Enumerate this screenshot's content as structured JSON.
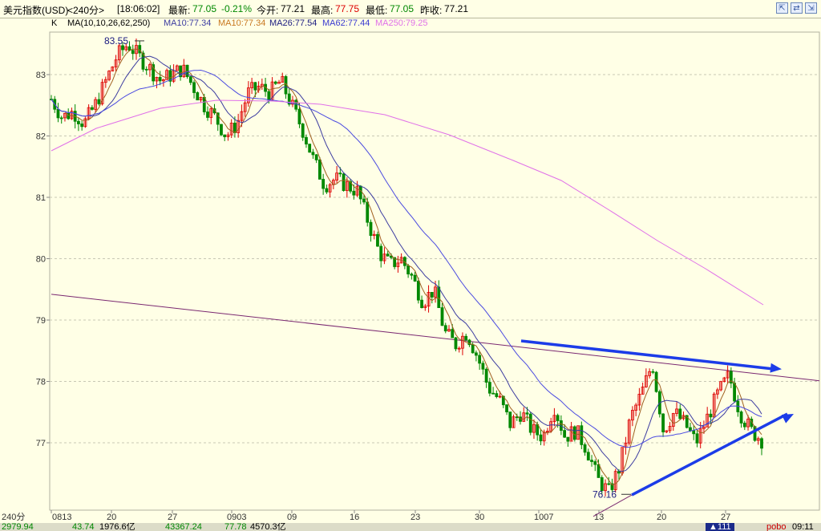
{
  "header": {
    "name": "美元指数(USD)",
    "period": "<240分>",
    "time": "[18:06:02]",
    "latest_label": "最新:",
    "latest": "77.05",
    "change": "-0.21%",
    "open_label": "今开:",
    "open": "77.21",
    "high_label": "最高:",
    "high": "77.75",
    "low_label": "最低:",
    "low": "77.05",
    "prev_label": "昨收:",
    "prev": "77.21"
  },
  "ma_bar": {
    "k_label": "K",
    "params": "MA(10,10,26,62,250)",
    "ma10a": "MA10:77.34",
    "ma10b": "MA10:77.34",
    "ma26": "MA26:77.54",
    "ma62": "MA62:77.44",
    "ma250": "MA250:79.25"
  },
  "bottom_bar": {
    "v1": "2979.94",
    "v2": "43.74",
    "v3": "1976.6亿",
    "v4": "43367.24",
    "v5": "77.78",
    "v6": "4570.3亿",
    "v7": "▲111",
    "v8": "pobo",
    "v9": "09:11"
  },
  "colors": {
    "up": "#dd0000",
    "down": "#008800",
    "ma10": "#a06020",
    "ma26": "#3c3ca0",
    "ma62": "#4a4ae0",
    "ma250": "#e070e8",
    "trendline": "#1c3ce8",
    "longline": "#7a2870"
  },
  "chart_data": {
    "type": "candlestick",
    "period_label": "240分",
    "y_ticks": [
      83,
      82,
      81,
      80,
      79,
      78,
      77
    ],
    "ylim": [
      76.0,
      83.9
    ],
    "x_tick_labels": [
      "0813",
      "20",
      "27",
      "0903",
      "09",
      "16",
      "23",
      "30",
      "1007",
      "13",
      "20",
      "27"
    ],
    "high_annotation": "83.55",
    "low_annotation": "76.16",
    "high_value": 83.55,
    "low_value": 76.16,
    "grid": true,
    "legend": "top-left",
    "approx_closes": [
      82.6,
      82.3,
      82.4,
      82.2,
      82.5,
      82.9,
      83.3,
      83.5,
      83.3,
      83.1,
      82.9,
      83.0,
      83.1,
      82.8,
      82.5,
      82.3,
      82.0,
      82.2,
      82.7,
      82.8,
      82.7,
      82.9,
      82.5,
      82.1,
      81.6,
      81.2,
      81.3,
      81.2,
      81.1,
      80.6,
      80.1,
      79.9,
      80.0,
      79.7,
      79.3,
      79.5,
      78.8,
      78.6,
      78.8,
      78.4,
      77.9,
      77.7,
      77.3,
      77.5,
      77.2,
      77.1,
      77.6,
      77.1,
      77.2,
      76.9,
      76.4,
      76.2,
      76.6,
      77.4,
      77.8,
      78.3,
      77.2,
      77.5,
      77.3,
      77.0,
      77.4,
      77.8,
      78.1,
      77.5,
      77.2,
      77.05
    ],
    "trendlines": [
      {
        "name": "upper",
        "from": {
          "date": "0930",
          "value": 78.66
        },
        "to": {
          "date": "1030",
          "value": 78.2
        }
      },
      {
        "name": "lower",
        "from": {
          "date": "1014",
          "value": 76.15
        },
        "to": {
          "date": "1030",
          "value": 77.47
        }
      },
      {
        "name": "long",
        "from": {
          "date": "0813",
          "value": 79.42
        },
        "to": {
          "date": "1030",
          "value": 78.01
        }
      }
    ]
  }
}
